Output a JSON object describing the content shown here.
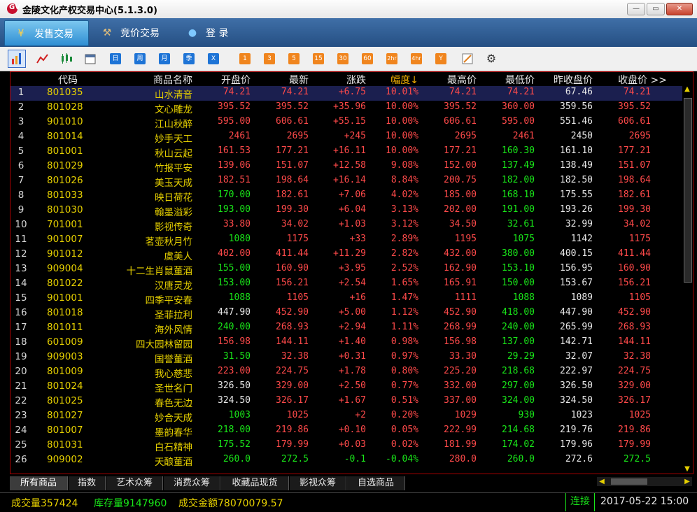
{
  "window": {
    "title": "金陵文化产权交易中心(5.1.3.0)",
    "logo_text": "GV",
    "minimize": "—",
    "maximize": "▭",
    "close": "✕"
  },
  "nav": {
    "tabs": [
      {
        "label": "发售交易",
        "icon": "¥"
      },
      {
        "label": "竞价交易",
        "icon": "⚒"
      },
      {
        "label": "登 录",
        "icon": "●"
      }
    ]
  },
  "toolbar": {
    "items": [
      "日",
      "周",
      "月",
      "季",
      "X",
      "1",
      "3",
      "5",
      "15",
      "30",
      "60",
      "2hr",
      "4hr",
      "Y"
    ]
  },
  "table": {
    "headers": [
      "代码",
      "商品名称",
      "开盘价",
      "最新",
      "涨跌",
      "幅度↓",
      "最高价",
      "最低价",
      "昨收盘价",
      "收盘价 >>"
    ],
    "rows": [
      [
        "1",
        "801035",
        "山水清音",
        "74.21",
        "74.21",
        "+6.75",
        "10.01%",
        "74.21",
        "74.21",
        "67.46",
        "74.21"
      ],
      [
        "2",
        "801028",
        "文心雕龙",
        "395.52",
        "395.52",
        "+35.96",
        "10.00%",
        "395.52",
        "360.00",
        "359.56",
        "395.52"
      ],
      [
        "3",
        "901010",
        "江山秋醉",
        "595.00",
        "606.61",
        "+55.15",
        "10.00%",
        "606.61",
        "595.00",
        "551.46",
        "606.61"
      ],
      [
        "4",
        "801014",
        "妙手天工",
        "2461",
        "2695",
        "+245",
        "10.00%",
        "2695",
        "2461",
        "2450",
        "2695"
      ],
      [
        "5",
        "801001",
        "秋山云起",
        "161.53",
        "177.21",
        "+16.11",
        "10.00%",
        "177.21",
        "160.30",
        "161.10",
        "177.21"
      ],
      [
        "6",
        "801029",
        "竹报平安",
        "139.06",
        "151.07",
        "+12.58",
        "9.08%",
        "152.00",
        "137.49",
        "138.49",
        "151.07"
      ],
      [
        "7",
        "801026",
        "美玉天成",
        "182.51",
        "198.64",
        "+16.14",
        "8.84%",
        "200.75",
        "182.00",
        "182.50",
        "198.64"
      ],
      [
        "8",
        "801033",
        "映日荷花",
        "170.00",
        "182.61",
        "+7.06",
        "4.02%",
        "185.00",
        "168.10",
        "175.55",
        "182.61"
      ],
      [
        "9",
        "801030",
        "翰墨溢彩",
        "193.00",
        "199.30",
        "+6.04",
        "3.13%",
        "202.00",
        "191.00",
        "193.26",
        "199.30"
      ],
      [
        "10",
        "701001",
        "影视传奇",
        "33.80",
        "34.02",
        "+1.03",
        "3.12%",
        "34.50",
        "32.61",
        "32.99",
        "34.02"
      ],
      [
        "11",
        "901007",
        "茗壶秋月竹",
        "1080",
        "1175",
        "+33",
        "2.89%",
        "1195",
        "1075",
        "1142",
        "1175"
      ],
      [
        "12",
        "901012",
        "虞美人",
        "402.00",
        "411.44",
        "+11.29",
        "2.82%",
        "432.00",
        "380.00",
        "400.15",
        "411.44"
      ],
      [
        "13",
        "909004",
        "十二生肖鼠董酒",
        "155.00",
        "160.90",
        "+3.95",
        "2.52%",
        "162.90",
        "153.10",
        "156.95",
        "160.90"
      ],
      [
        "14",
        "801022",
        "汉唐灵龙",
        "153.00",
        "156.21",
        "+2.54",
        "1.65%",
        "165.91",
        "150.00",
        "153.67",
        "156.21"
      ],
      [
        "15",
        "901001",
        "四季平安春",
        "1088",
        "1105",
        "+16",
        "1.47%",
        "1111",
        "1088",
        "1089",
        "1105"
      ],
      [
        "16",
        "801018",
        "圣菲拉利",
        "447.90",
        "452.90",
        "+5.00",
        "1.12%",
        "452.90",
        "418.00",
        "447.90",
        "452.90"
      ],
      [
        "17",
        "801011",
        "海外风情",
        "240.00",
        "268.93",
        "+2.94",
        "1.11%",
        "268.99",
        "240.00",
        "265.99",
        "268.93"
      ],
      [
        "18",
        "601009",
        "四大园林留园",
        "156.98",
        "144.11",
        "+1.40",
        "0.98%",
        "156.98",
        "137.00",
        "142.71",
        "144.11"
      ],
      [
        "19",
        "909003",
        "国誉董酒",
        "31.50",
        "32.38",
        "+0.31",
        "0.97%",
        "33.30",
        "29.29",
        "32.07",
        "32.38"
      ],
      [
        "20",
        "801009",
        "我心慈悲",
        "223.00",
        "224.75",
        "+1.78",
        "0.80%",
        "225.20",
        "218.68",
        "222.97",
        "224.75"
      ],
      [
        "21",
        "801024",
        "圣世名门",
        "326.50",
        "329.00",
        "+2.50",
        "0.77%",
        "332.00",
        "297.00",
        "326.50",
        "329.00"
      ],
      [
        "22",
        "801025",
        "春色无边",
        "324.50",
        "326.17",
        "+1.67",
        "0.51%",
        "337.00",
        "324.00",
        "324.50",
        "326.17"
      ],
      [
        "23",
        "801027",
        "妙合天成",
        "1003",
        "1025",
        "+2",
        "0.20%",
        "1029",
        "930",
        "1023",
        "1025"
      ],
      [
        "24",
        "801007",
        "墨韵春华",
        "218.00",
        "219.86",
        "+0.10",
        "0.05%",
        "222.99",
        "214.68",
        "219.76",
        "219.86"
      ],
      [
        "25",
        "801031",
        "白石精神",
        "175.52",
        "179.99",
        "+0.03",
        "0.02%",
        "181.99",
        "174.02",
        "179.96",
        "179.99"
      ],
      [
        "26",
        "909002",
        "天酿董酒",
        "260.0",
        "272.5",
        "-0.1",
        "-0.04%",
        "280.0",
        "260.0",
        "272.6",
        "272.5"
      ]
    ]
  },
  "sheet_tabs": [
    "所有商品",
    "指数",
    "艺术众筹",
    "消费众筹",
    "收藏品现货",
    "影视众筹",
    "自选商品"
  ],
  "status": {
    "volume": "成交量357424",
    "stock": "库存量9147960",
    "amount": "成交金额78070079.57",
    "connection": "连接",
    "datetime": "2017-05-22 15:00"
  }
}
